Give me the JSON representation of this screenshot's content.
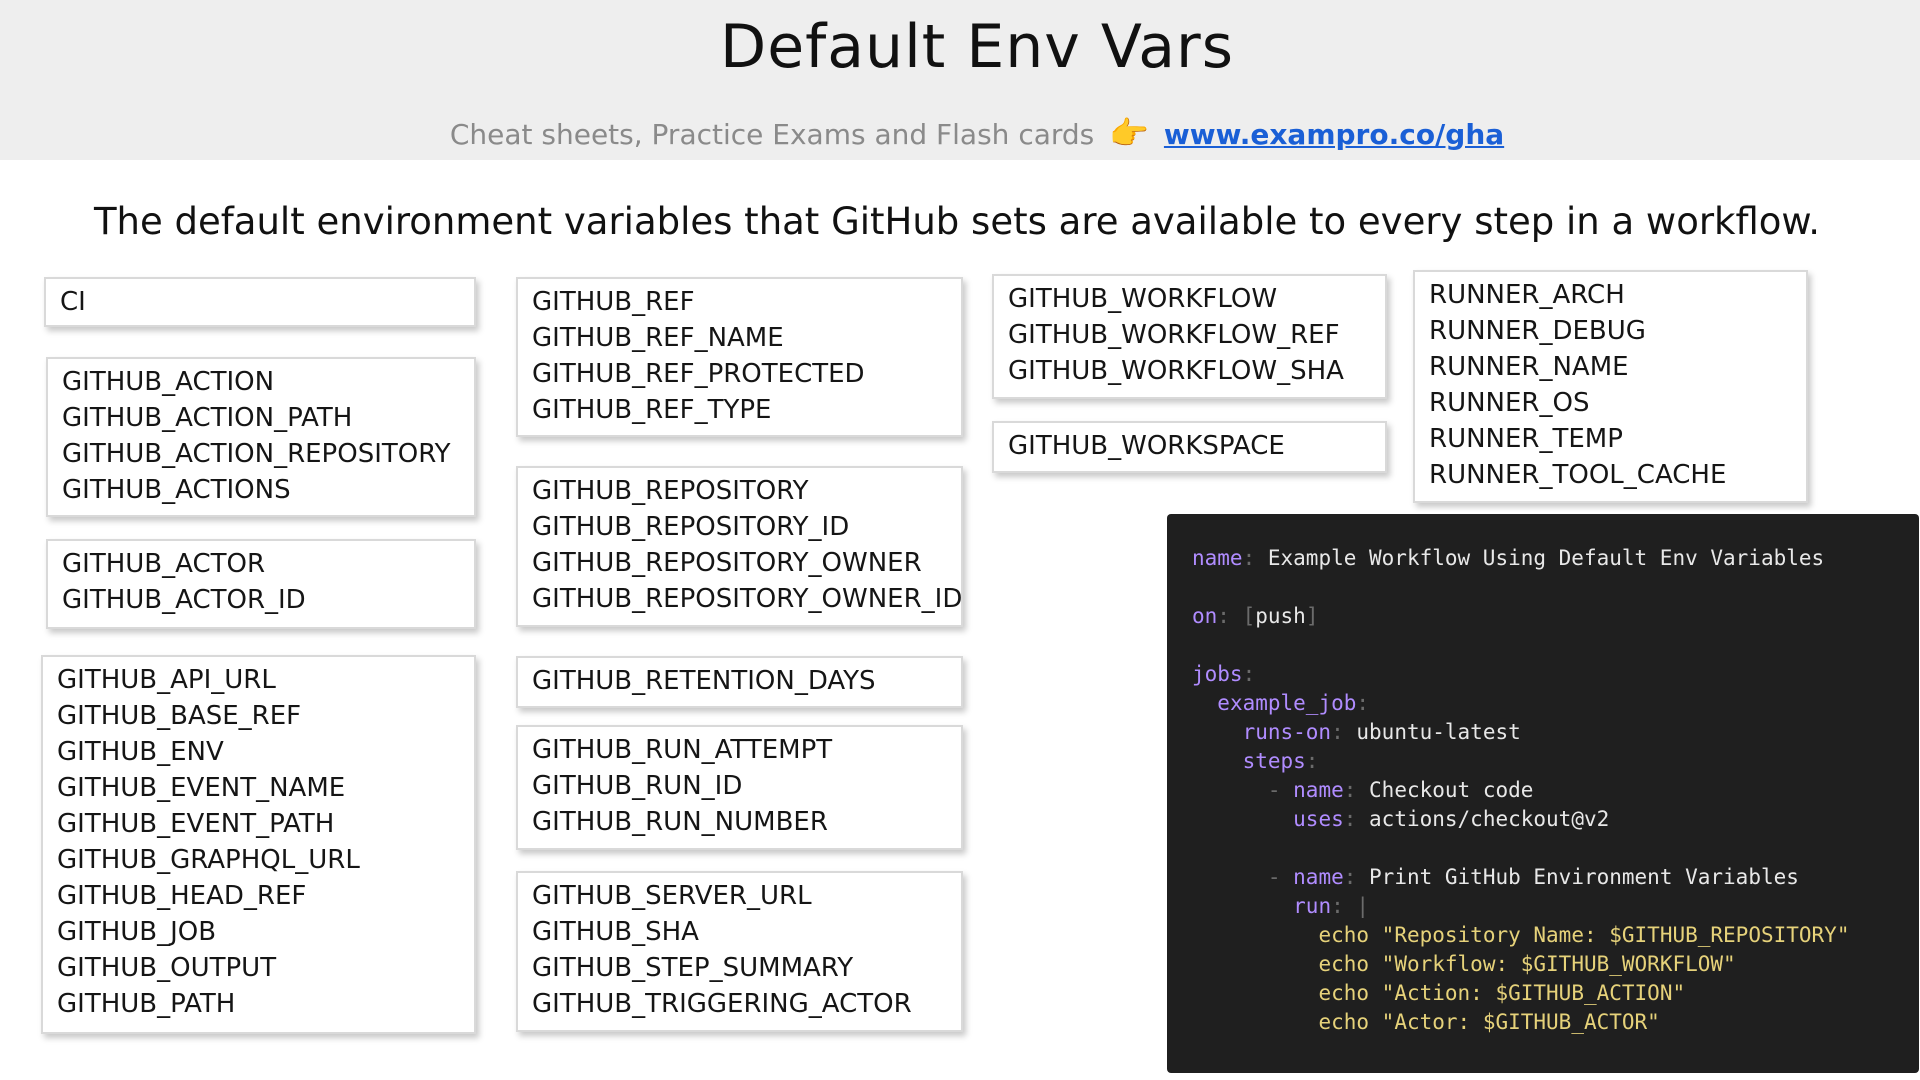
{
  "header": {
    "title": "Default Env Vars",
    "subtitle": "Cheat sheets, Practice Exams and Flash cards",
    "hand_icon": "pointing-hand-icon",
    "link": "www.exampro.co/gha"
  },
  "lead": "The default environment variables that GitHub sets are available to every step in a workflow.",
  "groups": {
    "ci": [
      "CI"
    ],
    "action": [
      "GITHUB_ACTION",
      "GITHUB_ACTION_PATH",
      "GITHUB_ACTION_REPOSITORY",
      "GITHUB_ACTIONS"
    ],
    "actor": [
      "GITHUB_ACTOR",
      "GITHUB_ACTOR_ID"
    ],
    "misc": [
      "GITHUB_API_URL",
      "GITHUB_BASE_REF",
      "GITHUB_ENV",
      "GITHUB_EVENT_NAME",
      "GITHUB_EVENT_PATH",
      "GITHUB_GRAPHQL_URL",
      "GITHUB_HEAD_REF",
      "GITHUB_JOB",
      "GITHUB_OUTPUT",
      "GITHUB_PATH"
    ],
    "ref": [
      "GITHUB_REF",
      "GITHUB_REF_NAME",
      "GITHUB_REF_PROTECTED",
      "GITHUB_REF_TYPE"
    ],
    "repository": [
      "GITHUB_REPOSITORY",
      "GITHUB_REPOSITORY_ID",
      "GITHUB_REPOSITORY_OWNER",
      "GITHUB_REPOSITORY_OWNER_ID"
    ],
    "retention": [
      "GITHUB_RETENTION_DAYS"
    ],
    "run": [
      "GITHUB_RUN_ATTEMPT",
      "GITHUB_RUN_ID",
      "GITHUB_RUN_NUMBER"
    ],
    "server": [
      "GITHUB_SERVER_URL",
      "GITHUB_SHA",
      "GITHUB_STEP_SUMMARY",
      "GITHUB_TRIGGERING_ACTOR"
    ],
    "workflow": [
      "GITHUB_WORKFLOW",
      "GITHUB_WORKFLOW_REF",
      "GITHUB_WORKFLOW_SHA"
    ],
    "workspace": [
      "GITHUB_WORKSPACE"
    ],
    "runner": [
      "RUNNER_ARCH",
      "RUNNER_DEBUG",
      "RUNNER_NAME",
      "RUNNER_OS",
      "RUNNER_TEMP",
      "RUNNER_TOOL_CACHE"
    ]
  },
  "code": {
    "name_key": "name",
    "name_val": "Example Workflow Using Default Env Variables",
    "on_key": "on",
    "on_val": "push",
    "jobs_key": "jobs",
    "job_key": "example_job",
    "runs_on_key": "runs-on",
    "runs_on_val": "ubuntu-latest",
    "steps_key": "steps",
    "step1_name_key": "name",
    "step1_name_val": "Checkout code",
    "step1_uses_key": "uses",
    "step1_uses_val": "actions/checkout@v2",
    "step2_name_key": "name",
    "step2_name_val": "Print GitHub Environment Variables",
    "step2_run_key": "run",
    "echo_cmd": "echo",
    "echo_lines": [
      "\"Repository Name: $GITHUB_REPOSITORY\"",
      "\"Workflow: $GITHUB_WORKFLOW\"",
      "\"Action: $GITHUB_ACTION\"",
      "\"Actor: $GITHUB_ACTOR\""
    ]
  }
}
